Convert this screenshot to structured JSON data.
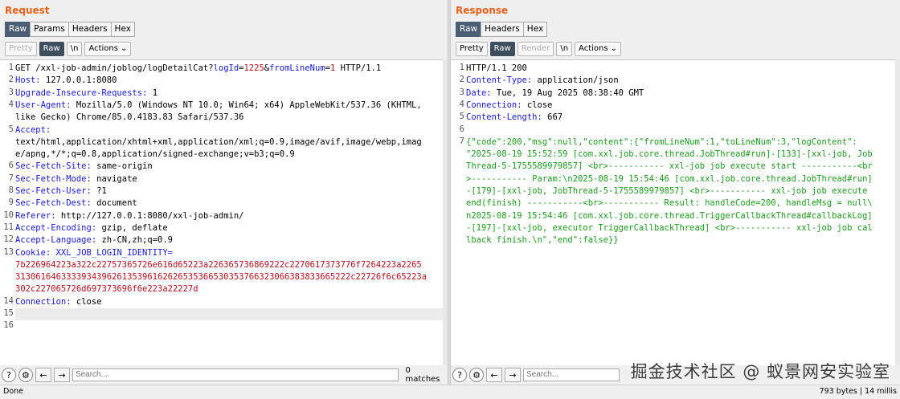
{
  "request": {
    "title": "Request",
    "tabs": [
      "Raw",
      "Params",
      "Headers",
      "Hex"
    ],
    "toolbar": {
      "pretty": "Pretty",
      "raw": "Raw",
      "newline": "\\n",
      "actions": "Actions"
    },
    "line_numbers": [
      "1",
      "2",
      "3",
      "4",
      "",
      "5",
      "",
      "",
      "6",
      "7",
      "8",
      "9",
      "10",
      "11",
      "12",
      "13",
      "",
      "",
      "",
      "14",
      "15",
      "16"
    ],
    "lines": [
      "GET /xxl-job-admin/joblog/logDetailCat?logId=1225&fromLineNum=1 HTTP/1.1",
      "Host: 127.0.0.1:8080",
      "Upgrade-Insecure-Requests: 1",
      "User-Agent: Mozilla/5.0 (Windows NT 10.0; Win64; x64) AppleWebKit/537.36 (KHTML,",
      "like Gecko) Chrome/85.0.4183.83 Safari/537.36",
      "Accept:",
      "text/html,application/xhtml+xml,application/xml;q=0.9,image/avif,image/webp,imag",
      "e/apng,*/*;q=0.8,application/signed-exchange;v=b3;q=0.9",
      "Sec-Fetch-Site: same-origin",
      "Sec-Fetch-Mode: navigate",
      "Sec-Fetch-User: ?1",
      "Sec-Fetch-Dest: document",
      "Referer: http://127.0.0.1:8080/xxl-job-admin/",
      "Accept-Encoding: gzip, deflate",
      "Accept-Language: zh-CN,zh;q=0.9",
      "Cookie: XXL_JOB_LOGIN_IDENTITY=",
      "7b226964223a322c22757365726e616d65223a226365736869222c2270617373776f7264223a2265",
      "313061646333393439626135396162626535366530353766323066383833665222c22726f6c65223a",
      "302c227065726d697373696f6e223a22227d",
      "Connection: close",
      "",
      ""
    ],
    "search_placeholder": "Search...",
    "matches": "0 matches"
  },
  "response": {
    "title": "Response",
    "tabs": [
      "Raw",
      "Headers",
      "Hex"
    ],
    "toolbar": {
      "pretty": "Pretty",
      "raw": "Raw",
      "render": "Render",
      "newline": "\\n",
      "actions": "Actions"
    },
    "line_numbers": [
      "1",
      "2",
      "3",
      "4",
      "5",
      "6",
      "7",
      "",
      "",
      "",
      "",
      "",
      "",
      "",
      "",
      ""
    ],
    "lines": [
      "HTTP/1.1 200",
      "Content-Type: application/json",
      "Date: Tue, 19 Aug 2025 08:38:40 GMT",
      "Connection: close",
      "Content-Length: 667",
      "",
      "{\"code\":200,\"msg\":null,\"content\":{\"fromLineNum\":1,\"toLineNum\":3,\"logContent\":",
      "\"2025-08-19 15:52:59 [com.xxl.job.core.thread.JobThread#run]-[133]-[xxl-job, Job",
      "Thread-5-1755589979857] <br>----------- xxl-job job execute start -----------<br",
      ">----------- Param:\\n2025-08-19 15:54:46 [com.xxl.job.core.thread.JobThread#run]",
      "-[179]-[xxl-job, JobThread-5-1755589979857] <br>----------- xxl-job job execute",
      "end(finish) -----------<br>----------- Result: handleCode=200, handleMsg = null\\",
      "n2025-08-19 15:54:46 [com.xxl.job.core.thread.TriggerCallbackThread#callbackLog]",
      "-[197]-[xxl-job, executor TriggerCallbackThread] <br>----------- xxl-job job cal",
      "lback finish.\\n\",\"end\":false}}",
      ""
    ],
    "search_placeholder": "Search..."
  },
  "status": {
    "left": "Done",
    "right": "793 bytes | 14 millis"
  },
  "watermark": "掘金技术社区 @ 蚁景网安实验室",
  "colors": {
    "accent": "#e8601c",
    "active_tab": "#4b5f74",
    "header_key": "#1a1ad0",
    "cookie": "#b0121b",
    "json_string": "#1f9a1f"
  }
}
